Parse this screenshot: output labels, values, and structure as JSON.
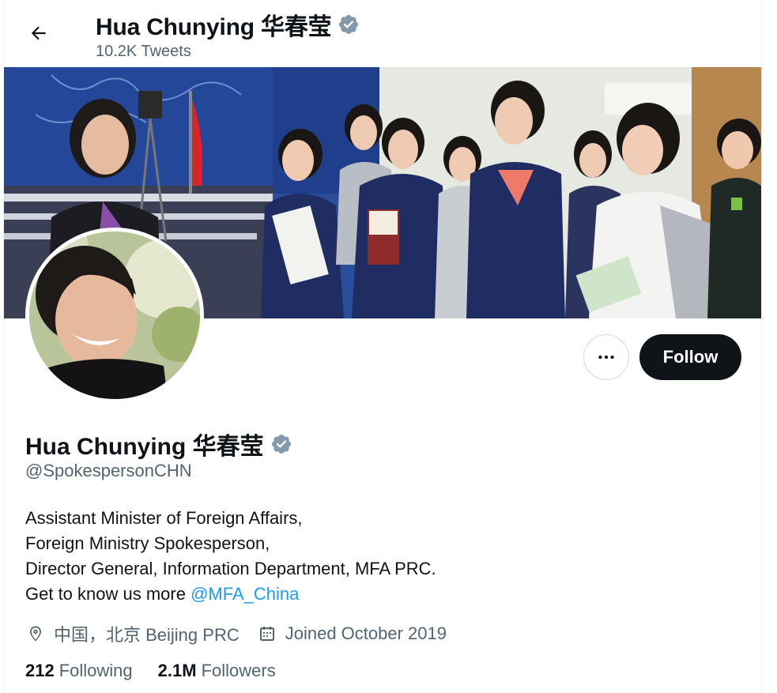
{
  "header": {
    "name": "Hua Chunying 华春莹",
    "tweet_count": "10.2K Tweets"
  },
  "profile": {
    "name": "Hua Chunying 华春莹",
    "handle": "@SpokespersonCHN",
    "verified_icon": "verified-badge-icon",
    "bio": {
      "line1": "Assistant Minister of Foreign Affairs,",
      "line2": "Foreign Ministry Spokesperson,",
      "line3": "Director General, Information Department, MFA PRC.",
      "line4_prefix": "Get to know us more ",
      "line4_link": "@MFA_China"
    },
    "location": "中国，北京 Beijing PRC",
    "joined": "Joined October 2019",
    "following_count": "212",
    "following_label": "Following",
    "followers_count": "2.1M",
    "followers_label": "Followers"
  },
  "actions": {
    "follow_label": "Follow",
    "more_icon": "more-dots-icon"
  },
  "colors": {
    "text_primary": "#0f1419",
    "text_secondary": "#536471",
    "link": "#1d9bf0",
    "verified_badge": "#829aab",
    "follow_bg": "#0f1419"
  }
}
